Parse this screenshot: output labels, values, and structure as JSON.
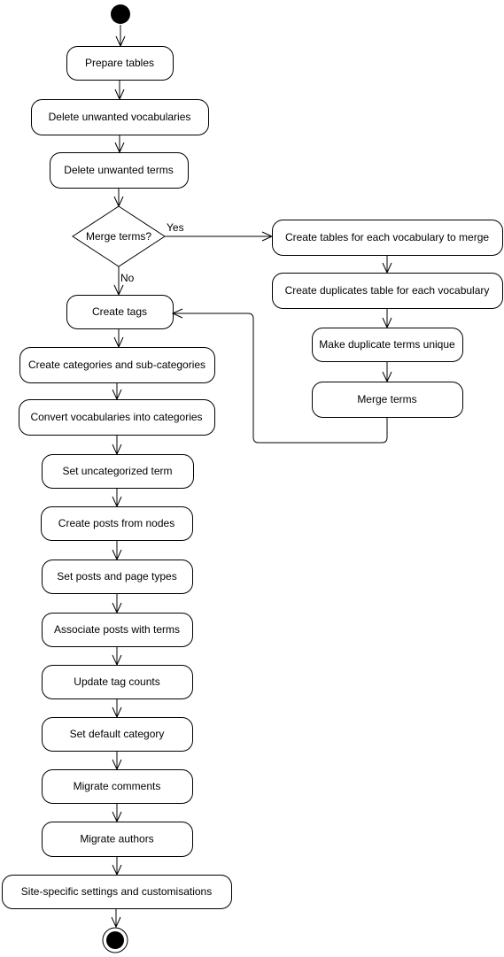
{
  "diagram": {
    "type": "activity",
    "nodes": [
      {
        "id": "prepare",
        "label": "Prepare tables"
      },
      {
        "id": "delvoc",
        "label": "Delete unwanted vocabularies"
      },
      {
        "id": "delterms",
        "label": "Delete unwanted terms"
      },
      {
        "id": "decision",
        "label": "Merge terms?",
        "shape": "diamond"
      },
      {
        "id": "ctables",
        "label": "Create tables for each vocabulary to merge"
      },
      {
        "id": "cdup",
        "label": "Create duplicates table for each vocabulary"
      },
      {
        "id": "unique",
        "label": "Make duplicate terms unique"
      },
      {
        "id": "merge",
        "label": "Merge terms"
      },
      {
        "id": "tags",
        "label": "Create tags"
      },
      {
        "id": "cats",
        "label": "Create categories and sub-categories"
      },
      {
        "id": "convert",
        "label": "Convert vocabularies into categories"
      },
      {
        "id": "uncat",
        "label": "Set uncategorized term"
      },
      {
        "id": "posts",
        "label": "Create posts from nodes"
      },
      {
        "id": "types",
        "label": "Set posts and page types"
      },
      {
        "id": "assoc",
        "label": "Associate posts with terms"
      },
      {
        "id": "counts",
        "label": "Update tag counts"
      },
      {
        "id": "defcat",
        "label": "Set default category"
      },
      {
        "id": "comments",
        "label": "Migrate comments"
      },
      {
        "id": "authors",
        "label": "Migrate authors"
      },
      {
        "id": "site",
        "label": "Site-specific settings and customisations"
      }
    ],
    "edge_labels": {
      "yes": "Yes",
      "no": "No"
    }
  }
}
